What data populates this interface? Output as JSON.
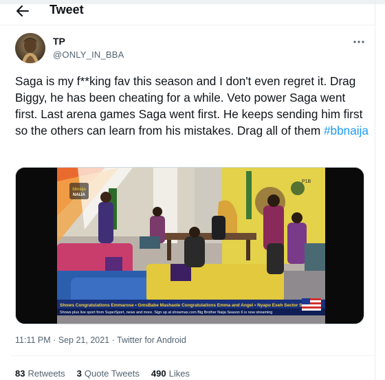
{
  "header": {
    "title": "Tweet",
    "back_icon": "arrow-left-icon"
  },
  "author": {
    "display_name": "TP",
    "handle": "@ONLY_IN_BBA",
    "avatar_icon": "profile-avatar"
  },
  "tweet": {
    "text": "Saga is my f**king fav this season and I don't even regret it. Drag Biggy, he has been cheating for a while. Veto power Saga went first. Last arena games Saga went first. He keeps sending him first so the others can learn from his mistakes. Drag all of them ",
    "hashtag": "#bbnaija"
  },
  "media": {
    "channel_logo_text": "bbnaija",
    "screen_label": "BIG BROTHER NAIJA",
    "corner_tag": "P1B",
    "ticker_line_1": "Shows Congratulations Emmarose • GmsBabe Mashaole Congratulations Emma and Angel • Nyapo Eseh Sector Sh",
    "ticker_line_2": "Shows plus live sport from SuperSport, news and more. Sign up at showmax.com  Big Brother Naija Season 6 is now streaming"
  },
  "meta": {
    "time": "11:11 PM",
    "separator": " · ",
    "date": "Sep 21, 2021",
    "source": "Twitter for Android"
  },
  "stats": {
    "retweets_count": "83",
    "retweets_label": "Retweets",
    "quote_count": "3",
    "quote_label": "Quote Tweets",
    "likes_count": "490",
    "likes_label": "Likes"
  },
  "colors": {
    "accent": "#1d9bf0",
    "secondary_text": "#536471",
    "primary_text": "#0f1419"
  }
}
